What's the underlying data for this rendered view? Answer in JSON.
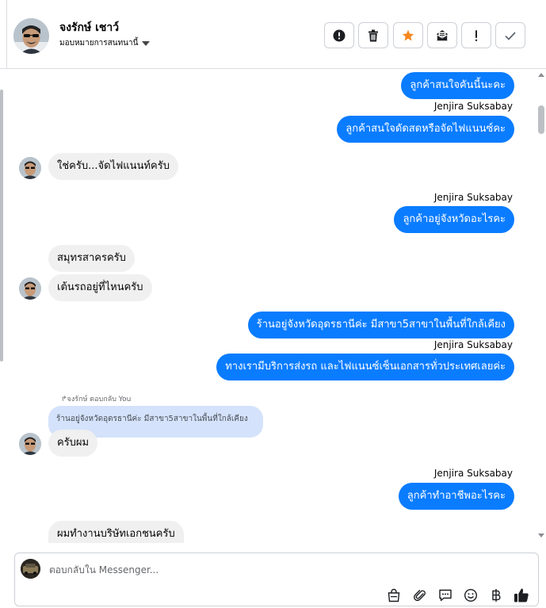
{
  "header": {
    "contact_name": "จงรักษ์ เชาว์",
    "assign_label": "มอบหมายการสนทนานี้",
    "tools": [
      {
        "name": "spam",
        "icon": "alert-circle-icon"
      },
      {
        "name": "delete",
        "icon": "trash-icon"
      },
      {
        "name": "star",
        "icon": "star-icon"
      },
      {
        "name": "mark-unread",
        "icon": "envelope-open-icon"
      },
      {
        "name": "follow-up",
        "icon": "exclamation-icon"
      },
      {
        "name": "done",
        "icon": "checkmark-icon"
      }
    ]
  },
  "messages": {
    "m1": "ลูกค้าสนใจคันนี้นะคะ",
    "s2": "Jenjira Suksabay",
    "m2": "ลูกค้าสนใจดัดสดหรือจัดไฟแนนซ์คะ",
    "m3": "ใช่ครับ...จัดไฟแนนท์ครับ",
    "s4": "Jenjira Suksabay",
    "m4": "ลูกค้าอยู่จังหวัดอะไรคะ",
    "m5": "สมุทรสาครครับ",
    "m6": "เต้นรถอยู่ที่ไหนครับ",
    "m7": "ร้านอยู่จังหวัดอุดรธานีค่ะ มีสาขา5สาขาในพื้นที่ใกล้เคียง",
    "s8": "Jenjira Suksabay",
    "m8": "ทางเรามีบริการส่งรถ และไฟแนนซ์เซ็นเอกสารทั่วประเทศเลยค่ะ",
    "reply_meta": "↱จงรักษ์ ตอบกลับ You",
    "quoted": "ร้านอยู่จังหวัดอุดรธานีค่ะ มีสาขา5สาขาในพื้นที่ใกล้เคียง",
    "m9": "ครับผม",
    "s10": "Jenjira Suksabay",
    "m10": "ลูกค้าทำอาชีพอะไรคะ",
    "m11": "ผมทำงานบริษัทเอกชนครับ"
  },
  "composer": {
    "placeholder": "ตอบกลับใน Messenger...",
    "icons": [
      "shopping-bag-icon",
      "paperclip-icon",
      "saved-replies-icon",
      "emoji-icon",
      "baht-icon",
      "thumbs-up-icon"
    ]
  },
  "colors": {
    "outgoing_bubble": "#0a7cff",
    "incoming_bubble": "#f0f0f0",
    "quoted_bubble": "#d4e2fb",
    "star": "#f5871f"
  }
}
